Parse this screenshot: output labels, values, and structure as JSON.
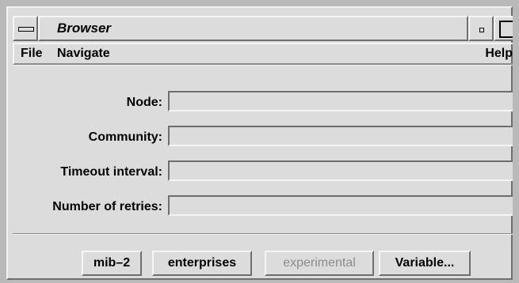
{
  "window": {
    "title": "Browser"
  },
  "menubar": {
    "file_label": "File",
    "navigate_label": "Navigate",
    "help_label": "Help"
  },
  "form": {
    "fields": [
      {
        "label": "Node:",
        "value": ""
      },
      {
        "label": "Community:",
        "value": ""
      },
      {
        "label": "Timeout interval:",
        "value": ""
      },
      {
        "label": "Number of retries:",
        "value": ""
      }
    ]
  },
  "buttons": {
    "mib2": "mib–2",
    "enterprises": "enterprises",
    "experimental": "experimental",
    "variable": "Variable..."
  },
  "states": {
    "experimental_enabled": false
  },
  "icons": {
    "window_menu": "window-menu-icon",
    "minimize": "minimize-icon",
    "maximize": "maximize-icon"
  },
  "colors": {
    "background": "#dcdcdc",
    "frame": "#b9b9b9",
    "disabled_text": "#8c8c8c"
  }
}
